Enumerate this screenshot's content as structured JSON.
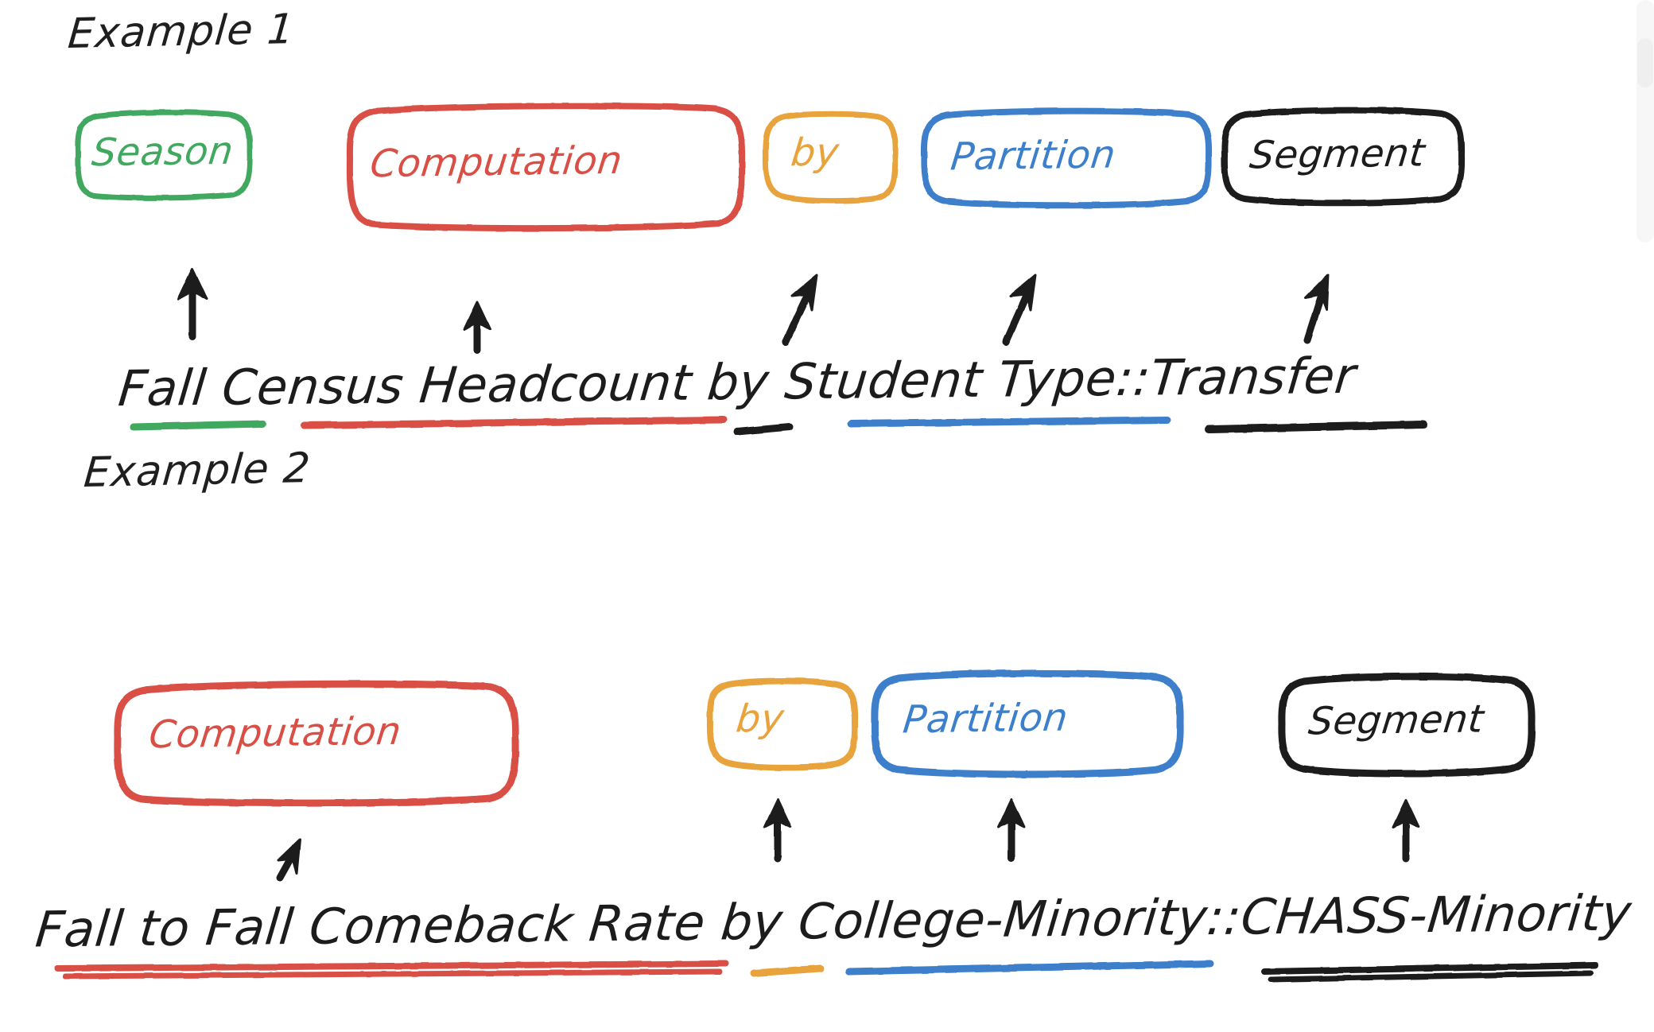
{
  "page": {
    "background_color": "#ffffff",
    "style": "hand-drawn whiteboard sketch"
  },
  "colors": {
    "green": "#41A85F",
    "red": "#D94F45",
    "orange": "#E8A33D",
    "blue": "#3C7FCB",
    "black": "#1C1C1C"
  },
  "examples": [
    {
      "heading": "Example 1",
      "boxes": [
        {
          "label": "Season",
          "color_key": "green"
        },
        {
          "label": "Computation",
          "color_key": "red"
        },
        {
          "label": "by",
          "color_key": "orange"
        },
        {
          "label": "Partition",
          "color_key": "blue"
        },
        {
          "label": "Segment",
          "color_key": "black"
        }
      ],
      "phrase_full": "Fall Census Headcount by Student Type::Transfer",
      "phrase_parts": [
        {
          "text": "Fall",
          "underline_color_key": "green"
        },
        {
          "text": "Census Headcount",
          "underline_color_key": "red"
        },
        {
          "text": "by",
          "underline_color_key": "black"
        },
        {
          "text": "Student Type",
          "underline_color_key": "blue"
        },
        {
          "text": "::",
          "underline_color_key": null
        },
        {
          "text": "Transfer",
          "underline_color_key": "black"
        }
      ]
    },
    {
      "heading": "Example 2",
      "boxes": [
        {
          "label": "Computation",
          "color_key": "red"
        },
        {
          "label": "by",
          "color_key": "orange"
        },
        {
          "label": "Partition",
          "color_key": "blue"
        },
        {
          "label": "Segment",
          "color_key": "black"
        }
      ],
      "phrase_full": "Fall to Fall Comeback Rate by College-Minority::CHASS-Minority",
      "phrase_parts": [
        {
          "text": "Fall to Fall Comeback Rate",
          "underline_color_key": "red"
        },
        {
          "text": "by",
          "underline_color_key": "orange"
        },
        {
          "text": "College-Minority",
          "underline_color_key": "blue"
        },
        {
          "text": "::",
          "underline_color_key": null
        },
        {
          "text": "CHASS-Minority",
          "underline_color_key": "black"
        }
      ]
    }
  ],
  "scrollbar": {
    "present": true
  }
}
